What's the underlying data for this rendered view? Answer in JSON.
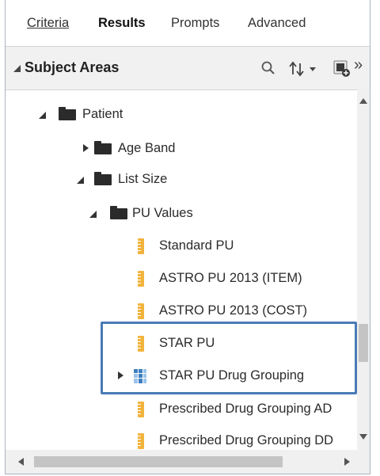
{
  "tabs": [
    {
      "label": "Criteria"
    },
    {
      "label": "Results"
    },
    {
      "label": "Prompts"
    },
    {
      "label": "Advanced"
    }
  ],
  "active_tab": "Results",
  "header": {
    "title": "Subject Areas",
    "icons": [
      "search-icon",
      "sort-icon",
      "add-subject-area-icon",
      "more-icon"
    ],
    "more_glyph": "»"
  },
  "tree": {
    "items": [
      {
        "label": "Patient",
        "icon": "folder-icon",
        "expanded": true
      },
      {
        "label": "Age Band",
        "icon": "folder-icon",
        "expanded": false
      },
      {
        "label": "List Size",
        "icon": "folder-icon",
        "expanded": true
      },
      {
        "label": "PU Values",
        "icon": "folder-icon",
        "expanded": true
      },
      {
        "label": "Standard PU",
        "icon": "measure-icon"
      },
      {
        "label": "ASTRO PU 2013 (ITEM)",
        "icon": "measure-icon"
      },
      {
        "label": "ASTRO PU 2013 (COST)",
        "icon": "measure-icon"
      },
      {
        "label": "STAR PU",
        "icon": "measure-icon"
      },
      {
        "label": "STAR PU Drug Grouping",
        "icon": "hierarchy-icon",
        "expanded": false
      },
      {
        "label": "Prescribed Drug Grouping AD",
        "icon": "measure-icon"
      },
      {
        "label": "Prescribed Drug Grouping DD",
        "icon": "measure-icon"
      }
    ]
  },
  "colors": {
    "highlight_border": "#4a7bb7",
    "measure_icon": "#f2b33d",
    "hierarchy_icon": "#3d7fc1"
  }
}
